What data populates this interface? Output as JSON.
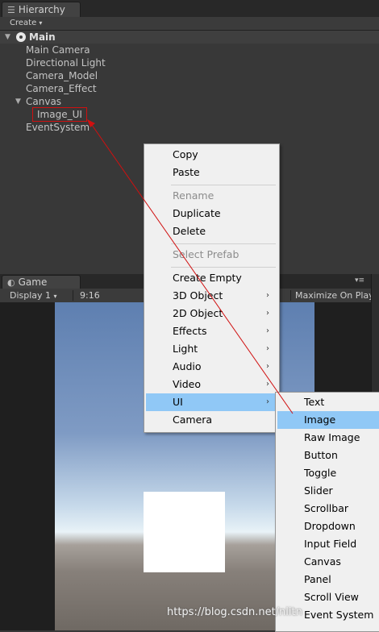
{
  "hierarchy": {
    "tab_title": "Hierarchy",
    "create_label": "Create",
    "scene_name": "Main",
    "items": [
      {
        "label": "Main Camera"
      },
      {
        "label": "Directional Light"
      },
      {
        "label": "Camera_Model"
      },
      {
        "label": "Camera_Effect"
      },
      {
        "label": "Canvas"
      },
      {
        "label": "Image_UI"
      },
      {
        "label": "EventSystem"
      }
    ]
  },
  "game": {
    "tab_title": "Game",
    "display": "Display 1",
    "aspect": "9:16",
    "maximize": "Maximize On Play"
  },
  "context_menu": {
    "items": [
      {
        "label": "Copy"
      },
      {
        "label": "Paste"
      },
      {
        "label": "Rename"
      },
      {
        "label": "Duplicate"
      },
      {
        "label": "Delete"
      },
      {
        "label": "Select Prefab"
      },
      {
        "label": "Create Empty"
      },
      {
        "label": "3D Object"
      },
      {
        "label": "2D Object"
      },
      {
        "label": "Effects"
      },
      {
        "label": "Light"
      },
      {
        "label": "Audio"
      },
      {
        "label": "Video"
      },
      {
        "label": "UI"
      },
      {
        "label": "Camera"
      }
    ]
  },
  "ui_submenu": {
    "items": [
      {
        "label": "Text"
      },
      {
        "label": "Image"
      },
      {
        "label": "Raw Image"
      },
      {
        "label": "Button"
      },
      {
        "label": "Toggle"
      },
      {
        "label": "Slider"
      },
      {
        "label": "Scrollbar"
      },
      {
        "label": "Dropdown"
      },
      {
        "label": "Input Field"
      },
      {
        "label": "Canvas"
      },
      {
        "label": "Panel"
      },
      {
        "label": "Scroll View"
      },
      {
        "label": "Event System"
      }
    ]
  },
  "watermark": "https://blog.csdn.net/nlitn",
  "colors": {
    "highlight": "#90c8f6",
    "annotation": "#d01010",
    "panel_bg": "#383838"
  }
}
